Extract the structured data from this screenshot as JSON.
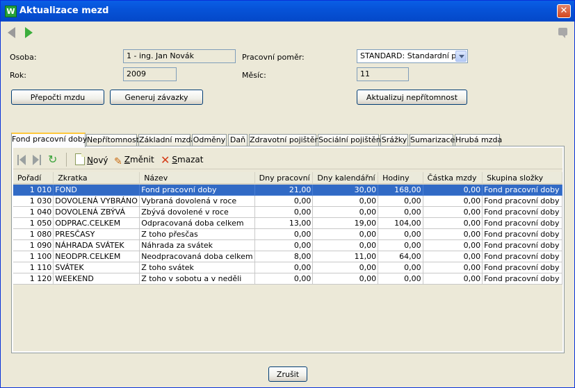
{
  "window": {
    "title": "Aktualizace mezd",
    "app_icon_letter": "W",
    "close_glyph": "✕"
  },
  "form": {
    "osoba_label": "Osoba:",
    "osoba_value": "1 - ing. Jan Novák",
    "rok_label": "Rok:",
    "rok_value": "2009",
    "pomer_label": "Pracovní poměr:",
    "pomer_value": "STANDARD: Standardní p...",
    "mesic_label": "Měsíc:",
    "mesic_value": "11"
  },
  "buttons": {
    "prepocti": "Přepočti mzdu",
    "generuj": "Generuj závazky",
    "aktualizuj": "Aktualizuj nepřítomnost",
    "zrusit": "Zrušit"
  },
  "tabs": [
    {
      "label": "Fond pracovní doby",
      "active": true
    },
    {
      "label": "Nepřítomnost",
      "active": false
    },
    {
      "label": "Základní mzda",
      "active": false
    },
    {
      "label": "Odměny",
      "active": false
    },
    {
      "label": "Daň",
      "active": false
    },
    {
      "label": "Zdravotní pojištění",
      "active": false
    },
    {
      "label": "Sociální pojištění",
      "active": false
    },
    {
      "label": "Srážky",
      "active": false
    },
    {
      "label": "Sumarizace",
      "active": false
    },
    {
      "label": "Hrubá mzda",
      "active": false
    }
  ],
  "toolbar": {
    "new_first": "N",
    "new_rest": "ový",
    "edit_first": "Z",
    "edit_rest": "měnit",
    "delete_first": "S",
    "delete_rest": "mazat"
  },
  "table": {
    "columns": [
      "Pořadí",
      "Zkratka",
      "Název",
      "Dny pracovní",
      "Dny kalendářní",
      "Hodiny",
      "Částka mzdy",
      "Skupina složky"
    ],
    "rows": [
      [
        "1 010",
        "FOND",
        "Fond pracovní  doby",
        "21,00",
        "30,00",
        "168,00",
        "0,00",
        "Fond pracovní doby"
      ],
      [
        "1 030",
        "DOVOLENÁ VYBRÁNO",
        "Vybraná dovolená v roce",
        "0,00",
        "0,00",
        "0,00",
        "0,00",
        "Fond pracovní doby"
      ],
      [
        "1 040",
        "DOVOLENÁ ZBÝVÁ",
        "Zbývá dovolené v roce",
        "0,00",
        "0,00",
        "0,00",
        "0,00",
        "Fond pracovní doby"
      ],
      [
        "1 050",
        "ODPRAC.CELKEM",
        "Odpracovaná doba celkem",
        "13,00",
        "19,00",
        "104,00",
        "0,00",
        "Fond pracovní doby"
      ],
      [
        "1 080",
        "PRESČASY",
        "Z toho  přesčas",
        "0,00",
        "0,00",
        "0,00",
        "0,00",
        "Fond pracovní doby"
      ],
      [
        "1 090",
        "NÁHRADA SVÁTEK",
        "Náhrada za svátek",
        "0,00",
        "0,00",
        "0,00",
        "0,00",
        "Fond pracovní doby"
      ],
      [
        "1 100",
        "NEODPR.CELKEM",
        "Neodpracovaná doba celkem",
        "8,00",
        "11,00",
        "64,00",
        "0,00",
        "Fond pracovní doby"
      ],
      [
        "1 110",
        "SVÁTEK",
        "Z toho  svátek",
        "0,00",
        "0,00",
        "0,00",
        "0,00",
        "Fond pracovní doby"
      ],
      [
        "1 120",
        "WEEKEND",
        "Z toho v sobotu a v neděli",
        "0,00",
        "0,00",
        "0,00",
        "0,00",
        "Fond pracovní doby"
      ]
    ],
    "selected_row": 0
  },
  "colors": {
    "titlebar": "#0653d8",
    "selection": "#316ac5",
    "tab_highlight": "#ffc83c"
  }
}
